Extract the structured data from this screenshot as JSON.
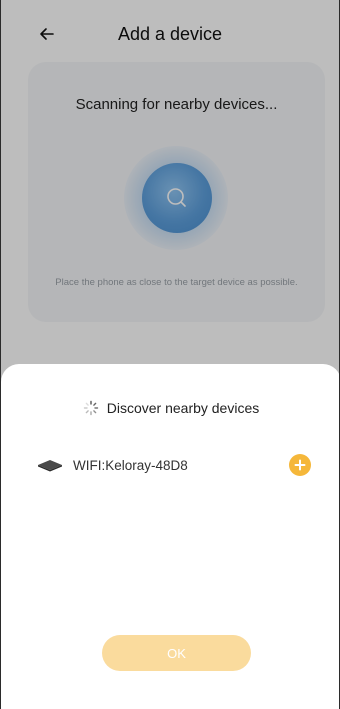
{
  "header": {
    "title": "Add a device",
    "back_icon": "back-arrow-icon"
  },
  "scan": {
    "title": "Scanning for nearby devices...",
    "hint": "Place the phone as close to the target device as possible.",
    "icon": "search-icon"
  },
  "sheet": {
    "title": "Discover nearby devices",
    "loading_icon": "loading-spinner-icon",
    "devices": [
      {
        "name": "WIFI:Keloray-48D8",
        "icon": "device-icon",
        "action_icon": "add-icon"
      }
    ],
    "ok_label": "OK"
  },
  "colors": {
    "accent": "#f5b73a",
    "ok_button_bg": "#fadb9d",
    "scan_orb": "#5d9fdc",
    "overlay": "rgba(0,0,0,0.26)"
  }
}
